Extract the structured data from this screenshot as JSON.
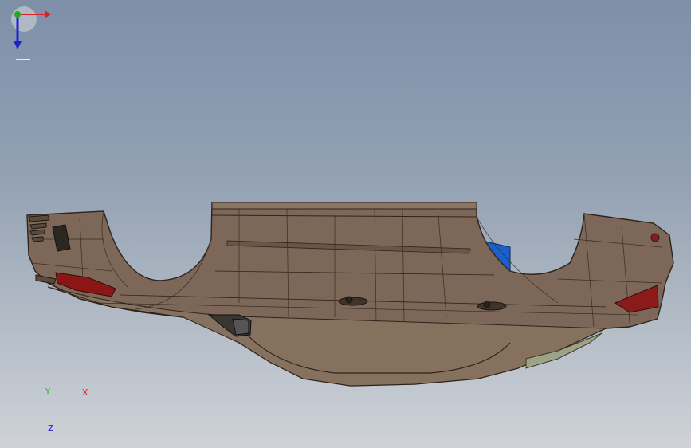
{
  "viewport": {
    "background_top": "#7e8fa8",
    "background_bottom": "#cfd3d8",
    "model_colors": {
      "body": "#7e6a5b",
      "body_edge": "#3a2e26",
      "glass": "#1460c8",
      "lamp": "#8a1a1a",
      "trim": "#9fa38a"
    }
  },
  "triad": {
    "x_label": "X",
    "y_label": "Y",
    "z_label": "Z",
    "x_color": "#dd2222",
    "y_color": "#22aa22",
    "z_color": "#2222cc"
  }
}
